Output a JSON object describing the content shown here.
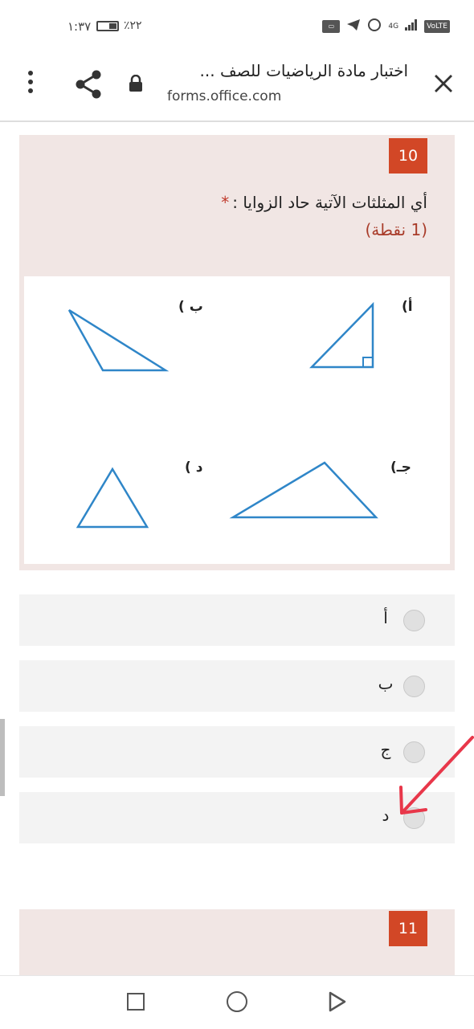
{
  "status": {
    "time": "١:٣٧",
    "battery": "٪٢٢",
    "network": "4G",
    "volte": "VoLTE"
  },
  "header": {
    "title": "اختبار مادة الرياضيات للصف ...",
    "url": "forms.office.com"
  },
  "question": {
    "number": "10",
    "text": "أي المثلثات الآتية حاد الزوايا :",
    "required_mark": "*",
    "points": "(1 نقطة)",
    "figure_labels": {
      "a": "أ)",
      "b": "ب )",
      "c": "جـ)",
      "d": "د )"
    }
  },
  "options": [
    {
      "label": "أ",
      "selected": false
    },
    {
      "label": "ب",
      "selected": false
    },
    {
      "label": "ج",
      "selected": false
    },
    {
      "label": "د",
      "selected": false
    }
  ],
  "next_question": {
    "number": "11",
    "text_partial": "..."
  },
  "colors": {
    "accent": "#d24726",
    "card_bg": "#f1e6e4",
    "triangle_stroke": "#2f86c8",
    "annotation": "#e8374a"
  },
  "icons": [
    "menu-icon",
    "share-icon",
    "lock-icon",
    "close-icon",
    "square-icon",
    "circle-icon",
    "triangle-back-icon"
  ]
}
